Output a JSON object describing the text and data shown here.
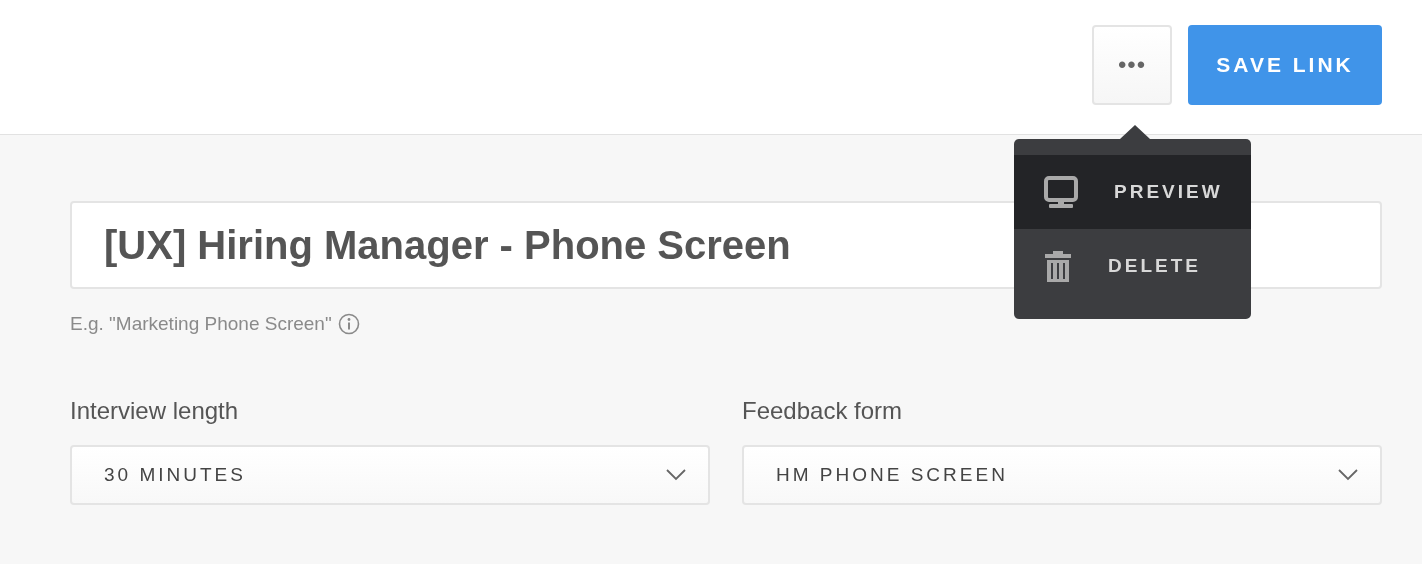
{
  "header": {
    "more_button": {
      "label": "•••"
    },
    "save_button": {
      "label": "SAVE LINK"
    }
  },
  "menu": {
    "items": [
      {
        "kind": "monitor",
        "label": "PREVIEW",
        "selected": true
      },
      {
        "kind": "trash",
        "label": "DELETE",
        "selected": false
      }
    ]
  },
  "title_field": {
    "value": "[UX] Hiring Manager - Phone Screen",
    "hint": "E.g. \"Marketing Phone Screen\""
  },
  "selects": [
    {
      "label": "Interview length",
      "value": "30 MINUTES"
    },
    {
      "label": "Feedback form",
      "value": "HM PHONE SCREEN"
    }
  ]
}
